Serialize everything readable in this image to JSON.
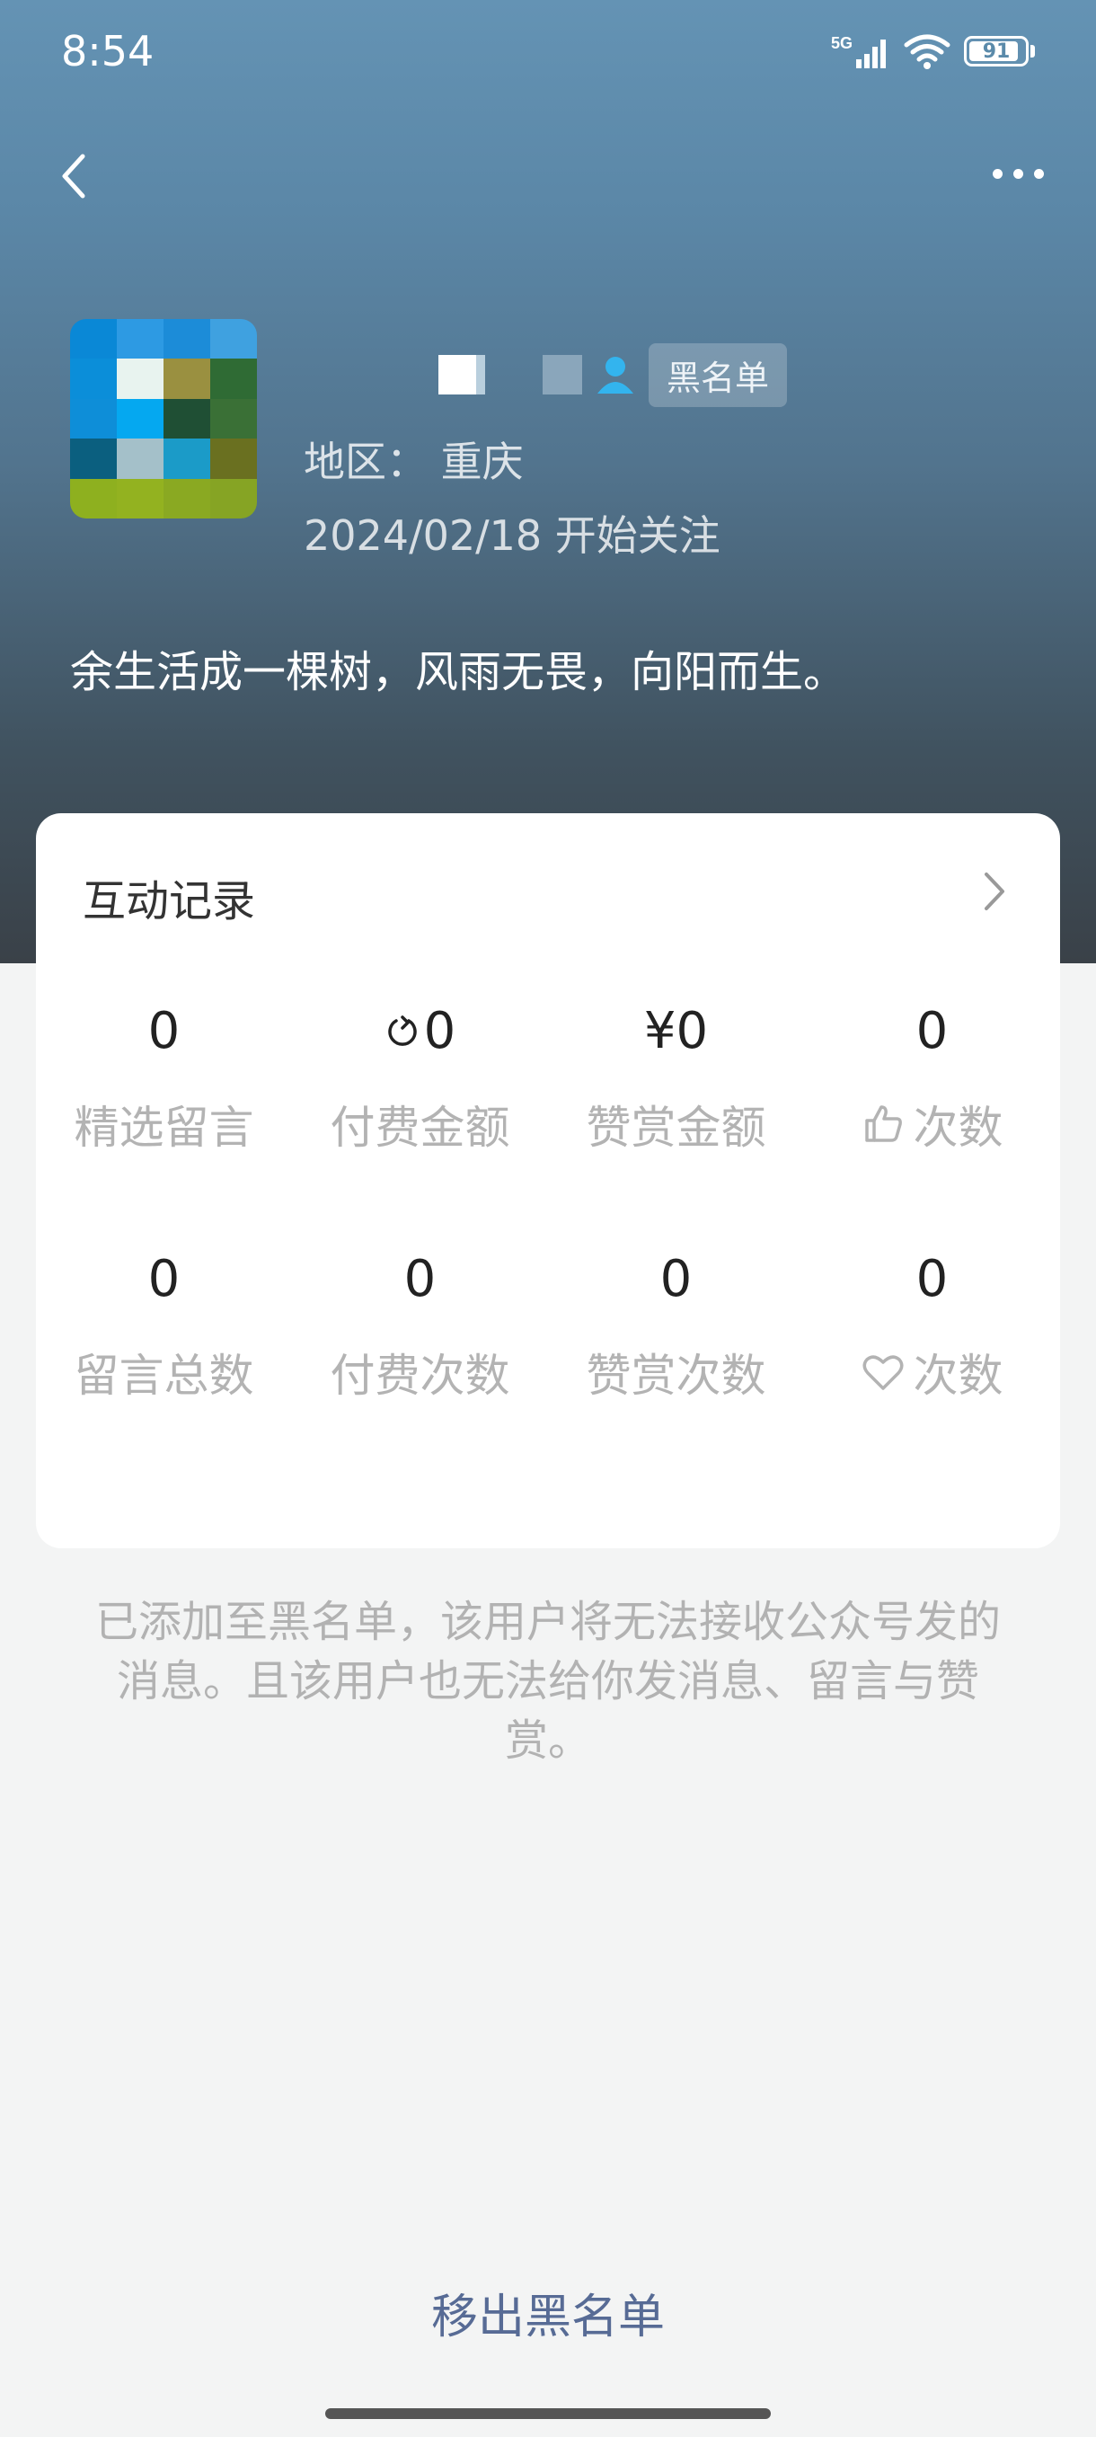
{
  "status_bar": {
    "time": "8:54",
    "network": "5G",
    "battery": "91",
    "battery_level": 0.91
  },
  "header": {
    "back_icon": "chevron-left-icon",
    "more_icon": "more-dots-icon"
  },
  "profile": {
    "name_redacted": true,
    "badge": "黑名单",
    "region": "地区：  重庆",
    "follow_date": "2024/02/18 开始关注",
    "signature": "余生活成一棵树，风雨无畏，向阳而生。"
  },
  "interaction": {
    "title": "互动记录",
    "stats": [
      {
        "value": "0",
        "label": "精选留言"
      },
      {
        "value": "0",
        "label": "付费金额",
        "value_icon": "coin-icon"
      },
      {
        "value": "¥0",
        "label": "赞赏金额"
      },
      {
        "value": "0",
        "label": "次数",
        "label_icon": "thumbs-up-icon"
      },
      {
        "value": "0",
        "label": "留言总数"
      },
      {
        "value": "0",
        "label": "付费次数"
      },
      {
        "value": "0",
        "label": "赞赏次数"
      },
      {
        "value": "0",
        "label": "次数",
        "label_icon": "heart-icon"
      }
    ]
  },
  "notice": "已添加至黑名单，该用户将无法接收公众号发的消息。且该用户也无法给你发消息、留言与赞赏。",
  "actions": {
    "remove_blacklist": "移出黑名单"
  },
  "colors": {
    "accent_link": "#576b95",
    "hero_top": "#6493b4",
    "hero_bottom": "#3a4148"
  }
}
